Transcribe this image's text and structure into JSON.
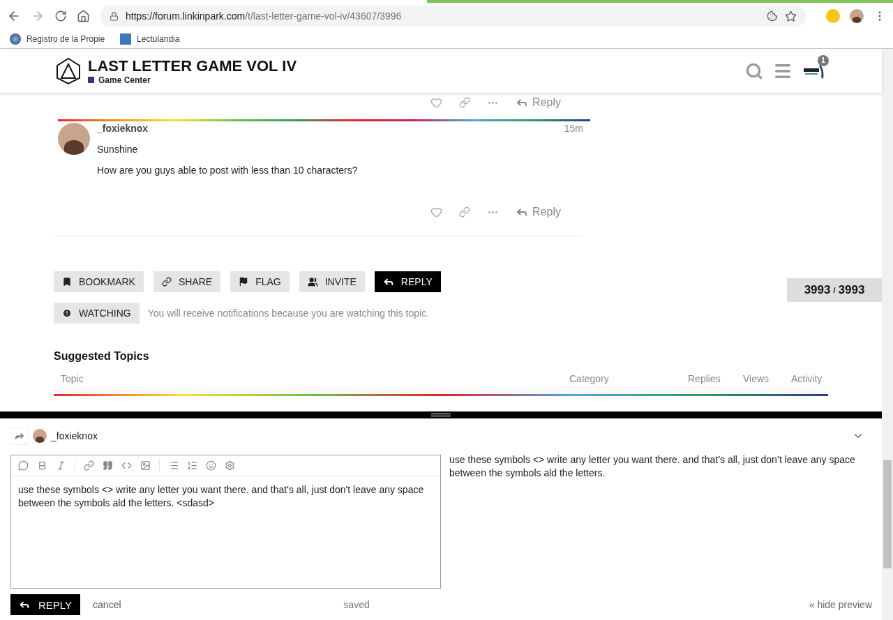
{
  "browser": {
    "url_host": "https://forum.linkinpark.com",
    "url_path": "/t/last-letter-game-vol-iv/43607/3996",
    "bookmarks": [
      {
        "label": "Registro de la Propie"
      },
      {
        "label": "Lectulandia"
      }
    ]
  },
  "header": {
    "title": "LAST LETTER GAME VOL IV",
    "category": "Game Center",
    "notification_count": "1"
  },
  "previous_post": {
    "reply": "Reply"
  },
  "post": {
    "username": "_foxieknox",
    "time": "15m",
    "paragraphs": [
      "Sunshine",
      "How are you guys able to post with less than 10 characters?"
    ],
    "reply": "Reply"
  },
  "topic_buttons": [
    {
      "kind": "bookmark",
      "label": "BOOKMARK",
      "primary": false
    },
    {
      "kind": "share",
      "label": "SHARE",
      "primary": false
    },
    {
      "kind": "flag",
      "label": "FLAG",
      "primary": false
    },
    {
      "kind": "invite",
      "label": "INVITE",
      "primary": false
    },
    {
      "kind": "reply",
      "label": "REPLY",
      "primary": true
    }
  ],
  "notification": {
    "button": "WATCHING",
    "text": "You will receive notifications because you are watching this topic."
  },
  "progress": {
    "current": "3993",
    "separator": "/",
    "total": "3993"
  },
  "suggested": {
    "title": "Suggested Topics",
    "columns": [
      "Topic",
      "Category",
      "Replies",
      "Views",
      "Activity"
    ]
  },
  "composer": {
    "reply_to": "_foxieknox",
    "text": "use these symbols <> write any letter you want there. and that's all, just don't leave any space between the symbols ald the letters. <sdasd>",
    "preview": "use these symbols <> write any letter you want there. and that’s all, just don’t leave any space between the symbols ald the letters.",
    "submit": "REPLY",
    "cancel": "cancel",
    "status": "saved",
    "hide_preview": "« hide preview"
  }
}
